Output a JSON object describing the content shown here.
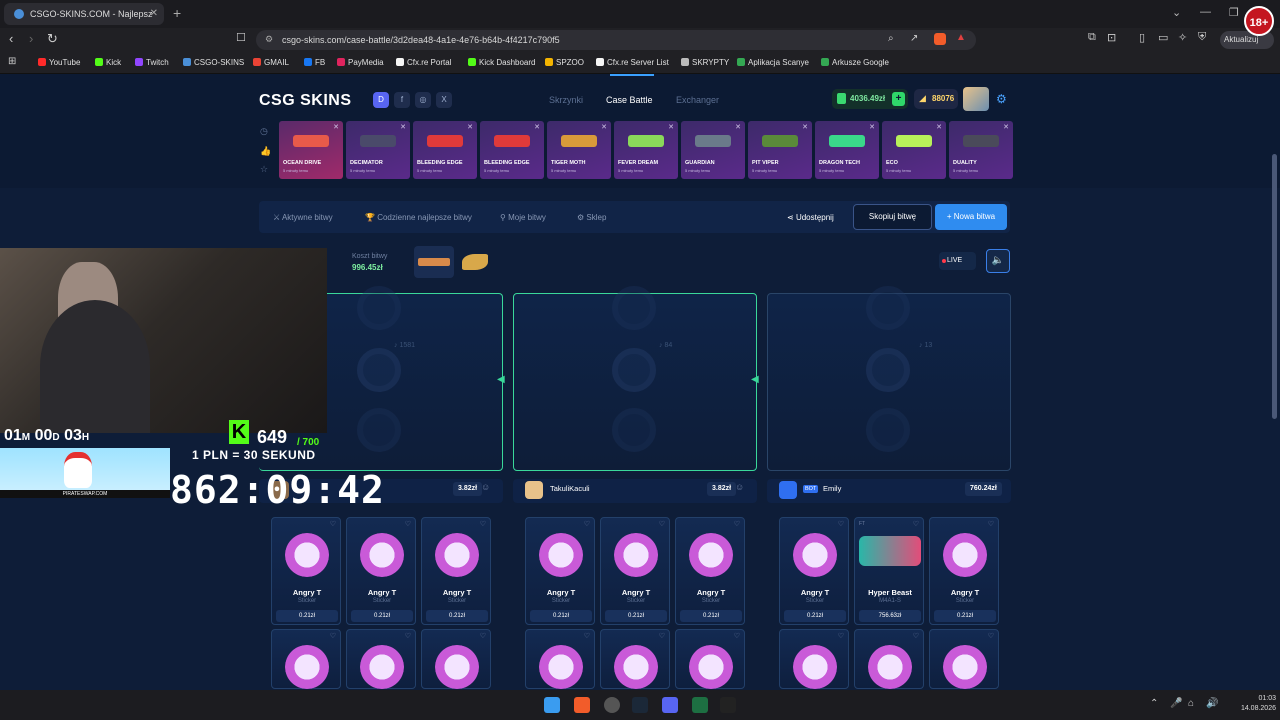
{
  "browser": {
    "tab_title": "CSGO-SKINS.COM - Najlepsz",
    "new_tab": "+",
    "url": "csgo-skins.com/case-battle/3d2dea48-4a1e-4e76-b64b-4f4217c790f5",
    "update_label": "Aktualizuj",
    "age_badge": "18+"
  },
  "bookmarks": [
    {
      "label": "YouTube",
      "color": "#ff2a2a"
    },
    {
      "label": "Kick",
      "color": "#53fc18"
    },
    {
      "label": "Twitch",
      "color": "#9146ff"
    },
    {
      "label": "CSGO-SKINS",
      "color": "#4a8fd8"
    },
    {
      "label": "GMAIL",
      "color": "#ea4335"
    },
    {
      "label": "FB",
      "color": "#1877f2"
    },
    {
      "label": "PayMedia",
      "color": "#e0245e"
    },
    {
      "label": "Cfx.re Portal",
      "color": "#f5f5f5"
    },
    {
      "label": "Kick Dashboard",
      "color": "#53fc18"
    },
    {
      "label": "SPZOO",
      "color": "#f4b400"
    },
    {
      "label": "Cfx.re Server List",
      "color": "#f5f5f5"
    },
    {
      "label": "SKRYPTY",
      "color": "#bbbbbb"
    },
    {
      "label": "Aplikacja Scanye",
      "color": "#34a853"
    },
    {
      "label": "Arkusze Google",
      "color": "#34a853"
    }
  ],
  "site": {
    "logo": "CSG SKINS",
    "social": [
      "D",
      "f",
      "◎",
      "X"
    ],
    "nav": [
      "Skrzynki",
      "Case Battle",
      "Exchanger"
    ],
    "balance": "4036.49zł",
    "coins": "88076"
  },
  "drops": [
    {
      "name": "OCEAN DRIVE",
      "sub": "5 minuty temu",
      "gun_color": "#e85a4a",
      "red": true
    },
    {
      "name": "DECIMATOR",
      "sub": "5 minuty temu",
      "gun_color": "#4a4a6a",
      "red": false
    },
    {
      "name": "BLEEDING EDGE",
      "sub": "5 minuty temu",
      "gun_color": "#e03a3a",
      "red": false
    },
    {
      "name": "BLEEDING EDGE",
      "sub": "5 minuty temu",
      "gun_color": "#e03a3a",
      "red": false
    },
    {
      "name": "TIGER MOTH",
      "sub": "5 minuty temu",
      "gun_color": "#d89a3a",
      "red": false
    },
    {
      "name": "FEVER DREAM",
      "sub": "5 minuty temu",
      "gun_color": "#8ad85a",
      "red": false
    },
    {
      "name": "GUARDIAN",
      "sub": "5 minuty temu",
      "gun_color": "#6a7a8a",
      "red": false
    },
    {
      "name": "PIT VIPER",
      "sub": "5 minuty temu",
      "gun_color": "#5a8a3a",
      "red": false
    },
    {
      "name": "DRAGON TECH",
      "sub": "5 minuty temu",
      "gun_color": "#3ad88a",
      "red": false
    },
    {
      "name": "ECO",
      "sub": "5 minuty temu",
      "gun_color": "#b8f05a",
      "red": false
    },
    {
      "name": "DUALITY",
      "sub": "5 minuty temu",
      "gun_color": "#4a4a5a",
      "red": false
    }
  ],
  "toolbar": {
    "active": "Aktywne bitwy",
    "daily": "Codzienne najlepsze bitwy",
    "mine": "Moje bitwy",
    "shop": "Sklep",
    "share": "Udostępnij",
    "copy": "Skopiuj bitwę",
    "new": "+ Nowa bitwa"
  },
  "battle": {
    "cost_label": "Koszt bitwy",
    "cost_value": "996.45zł",
    "live": "LIVE",
    "counters": [
      "♪ 1581",
      "♪ 84",
      "♪ 13"
    ]
  },
  "players": [
    {
      "name": "",
      "price": "3.82zł",
      "avatar_color": "#8a6a4a"
    },
    {
      "name": "TakuliKaculi",
      "price": "3.82zł",
      "avatar_color": "#e8c28a"
    },
    {
      "name": "Emily",
      "price": "760.24zł",
      "avatar_color": "#2f6ff0",
      "bot": "BOT"
    }
  ],
  "cards": [
    [
      {
        "name": "Angry T",
        "type": "Sticker",
        "price": "0.21zł"
      },
      {
        "name": "Angry T",
        "type": "Sticker",
        "price": "0.21zł"
      },
      {
        "name": "Angry T",
        "type": "Sticker",
        "price": "0.21zł"
      }
    ],
    [
      {
        "name": "Angry T",
        "type": "Sticker",
        "price": "0.21zł"
      },
      {
        "name": "Angry T",
        "type": "Sticker",
        "price": "0.21zł"
      },
      {
        "name": "Angry T",
        "type": "Sticker",
        "price": "0.21zł"
      }
    ],
    [
      {
        "name": "Angry T",
        "type": "Sticker",
        "price": "0.21zł"
      },
      {
        "name": "Hyper Beast",
        "type": "M4A1-S",
        "price": "756.63zł",
        "ft": "FT"
      },
      {
        "name": "Angry T",
        "type": "Sticker",
        "price": "0.21zł"
      }
    ]
  ],
  "stream": {
    "time_left": [
      "01",
      "M",
      "00",
      "D",
      "03",
      "H"
    ],
    "subs": "649",
    "subs_goal": "/ 700",
    "rate": "1 PLN = 30 SEKUND",
    "timer": "862:09:42",
    "ad_text": "PIRATESWAP.COM"
  },
  "taskbar": {
    "time": "01:03",
    "date": "14.08.2026"
  }
}
